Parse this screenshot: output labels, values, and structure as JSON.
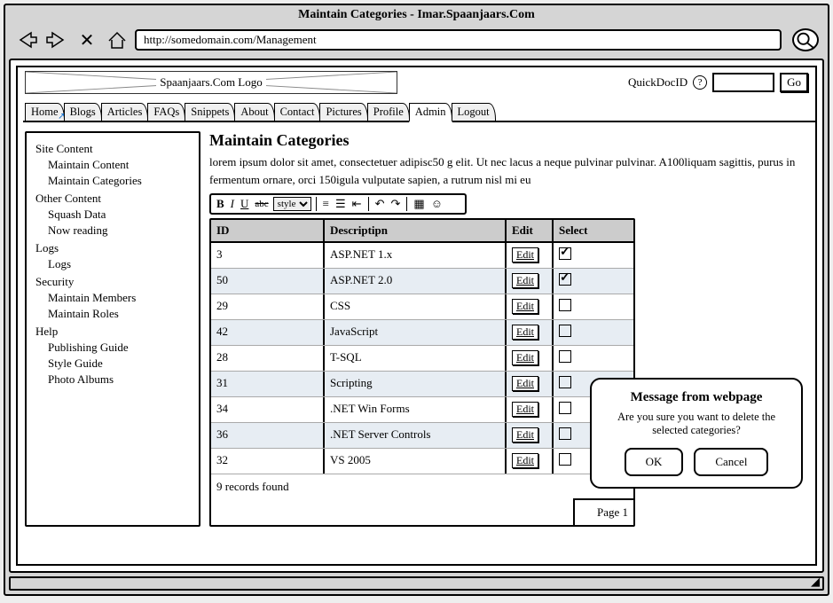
{
  "window": {
    "title": "Maintain Categories - Imar.Spaanjaars.Com",
    "url": "http://somedomain.com/Management"
  },
  "header": {
    "logo_text": "Spaanjaars.Com Logo",
    "quickdoc_label": "QuickDocID",
    "go_label": "Go"
  },
  "tabs": [
    {
      "label": "Home",
      "active": false
    },
    {
      "label": "Blogs",
      "active": false
    },
    {
      "label": "Articles",
      "active": false
    },
    {
      "label": "FAQs",
      "active": false
    },
    {
      "label": "Snippets",
      "active": false
    },
    {
      "label": "About",
      "active": false
    },
    {
      "label": "Contact",
      "active": false
    },
    {
      "label": "Pictures",
      "active": false
    },
    {
      "label": "Profile",
      "active": false
    },
    {
      "label": "Admin",
      "active": true
    },
    {
      "label": "Logout",
      "active": false
    }
  ],
  "sidebar": [
    {
      "title": "Site Content",
      "items": [
        "Maintain Content",
        "Maintain Categories"
      ]
    },
    {
      "title": "Other Content",
      "items": [
        "Squash Data",
        "Now reading"
      ]
    },
    {
      "title": "Logs",
      "items": [
        "Logs"
      ]
    },
    {
      "title": "Security",
      "items": [
        "Maintain Members",
        "Maintain Roles"
      ]
    },
    {
      "title": "Help",
      "items": [
        "Publishing Guide",
        "Style Guide",
        "Photo Albums"
      ]
    }
  ],
  "main": {
    "heading": "Maintain Categories",
    "description": "lorem ipsum dolor sit amet, consectetuer adipisc50 g elit. Ut nec lacus a neque pulvinar pulvinar. A100liquam sagittis, purus in fermentum ornare, orci 150igula vulputate sapien, a rutrum nisl mi eu",
    "toolbar": {
      "style_label": "style"
    },
    "columns": [
      "ID",
      "Descriptipn",
      "Edit",
      "Select"
    ],
    "rows": [
      {
        "id": "3",
        "desc": "ASP.NET 1.x",
        "checked": true
      },
      {
        "id": "50",
        "desc": "ASP.NET 2.0",
        "checked": true
      },
      {
        "id": "29",
        "desc": "CSS",
        "checked": false
      },
      {
        "id": "42",
        "desc": "JavaScript",
        "checked": false
      },
      {
        "id": "28",
        "desc": "T-SQL",
        "checked": false
      },
      {
        "id": "31",
        "desc": "Scripting",
        "checked": false
      },
      {
        "id": "34",
        "desc": ".NET Win Forms",
        "checked": false
      },
      {
        "id": "36",
        "desc": ".NET Server Controls",
        "checked": false
      },
      {
        "id": "32",
        "desc": "VS 2005",
        "checked": false
      }
    ],
    "edit_label": "Edit",
    "footer_text": "9 records found",
    "page_label": "Page 1"
  },
  "modal": {
    "title": "Message from webpage",
    "text": "Are you sure you want to delete the selected categories?",
    "ok": "OK",
    "cancel": "Cancel"
  }
}
